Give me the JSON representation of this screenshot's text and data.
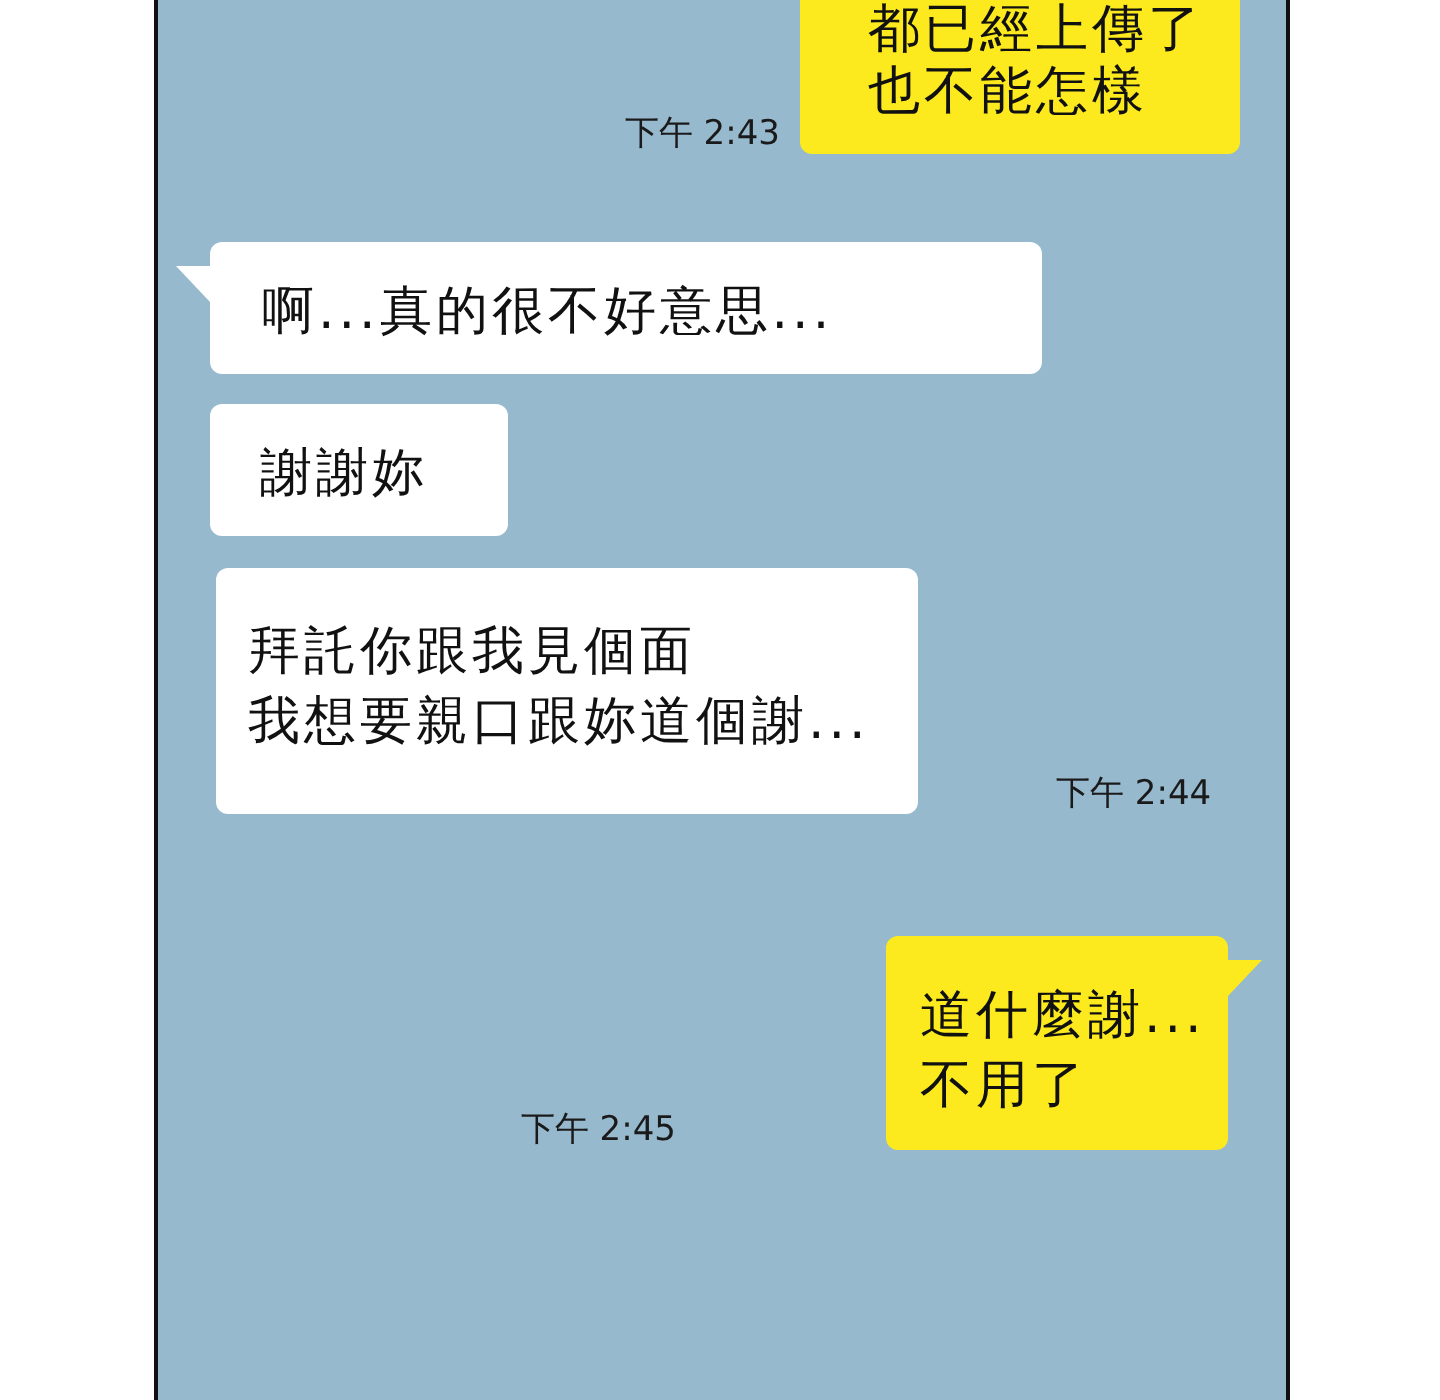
{
  "chat": {
    "messages": [
      {
        "kind": "sent",
        "tail": false,
        "lines": [
          "都已經上傳了",
          "也不能怎樣"
        ],
        "time": "下午 2:43"
      },
      {
        "kind": "received",
        "tail": true,
        "lines": [
          "啊...真的很不好意思..."
        ]
      },
      {
        "kind": "received",
        "tail": false,
        "lines": [
          "謝謝妳"
        ]
      },
      {
        "kind": "received",
        "tail": false,
        "lines": [
          "拜託你跟我見個面",
          "我想要親口跟妳道個謝..."
        ],
        "time": "下午 2:44"
      },
      {
        "kind": "sent",
        "tail": true,
        "lines": [
          "道什麼謝...",
          "不用了"
        ],
        "time": "下午 2:45"
      }
    ]
  }
}
